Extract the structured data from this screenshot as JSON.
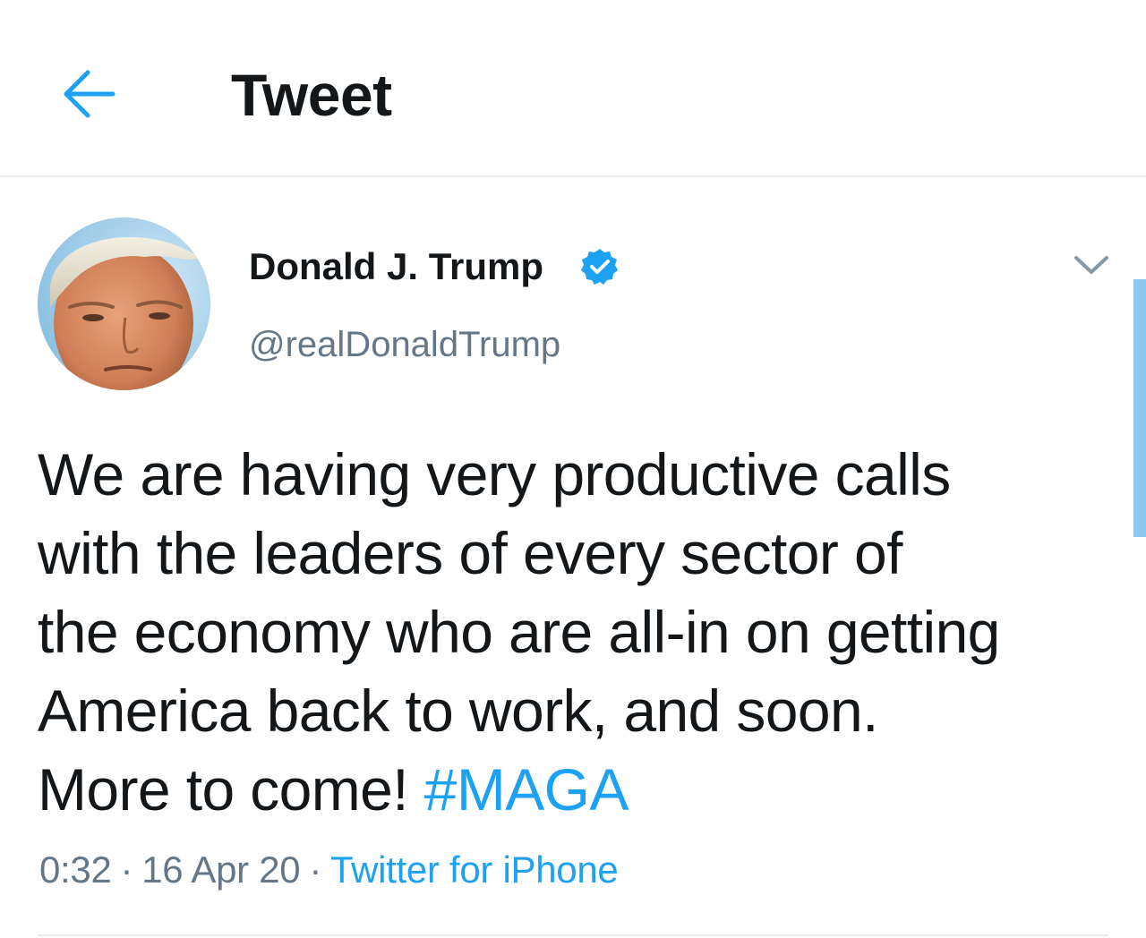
{
  "header": {
    "title": "Tweet",
    "back_icon": "arrow-left-icon"
  },
  "tweet": {
    "author_name": "Donald J. Trump",
    "verified_icon": "verified-badge-icon",
    "handle": "@realDonaldTrump",
    "menu_icon": "chevron-down-icon",
    "text_lines": [
      "We are having very productive calls",
      "with the leaders of every sector of",
      "the economy who are all-in on getting",
      "America back to work, and soon."
    ],
    "last_line_text": "More to come! ",
    "hashtag": "#MAGA",
    "time": "0:32",
    "separator": "·",
    "date": "16 Apr 20",
    "source": "Twitter for iPhone"
  },
  "colors": {
    "accent": "#1da1f2",
    "text_primary": "#14171a",
    "text_secondary": "#657786",
    "divider": "#e6ecf0"
  }
}
